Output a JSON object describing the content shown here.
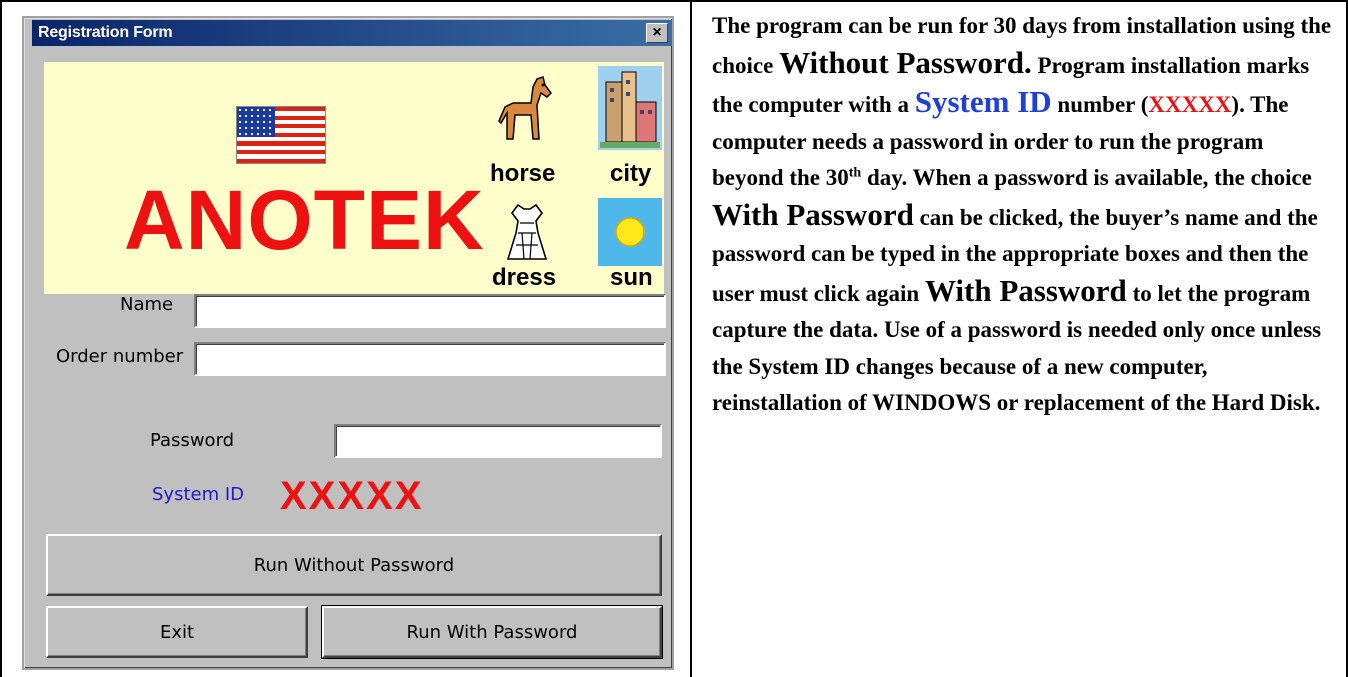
{
  "window": {
    "title": "Registration Form",
    "close_label": "×"
  },
  "banner": {
    "brand": "ANOTEK",
    "flag_icon": "us-flag-icon",
    "pictures": [
      {
        "label": "horse",
        "icon": "horse-icon"
      },
      {
        "label": "city",
        "icon": "city-icon"
      },
      {
        "label": "dress",
        "icon": "dress-icon"
      },
      {
        "label": "sun",
        "icon": "sun-icon"
      }
    ]
  },
  "form": {
    "name_label": "Name",
    "name_value": "",
    "order_label": "Order number",
    "order_value": "",
    "password_label": "Password",
    "password_value": "",
    "sysid_label": "System ID",
    "sysid_value": "XXXXX"
  },
  "buttons": {
    "run_without": "Run Without Password",
    "exit": "Exit",
    "run_with": "Run With Password"
  },
  "description": {
    "p1": "The program can be run for 30 days from installation using the choice ",
    "without_password": "Without Password.",
    "p2": " Program installation marks the computer with a ",
    "system_id": "System ID",
    "p3": " number (",
    "xxxxx": "XXXXX",
    "p4": "). The computer needs a password in order to run the program beyond the 30",
    "th": "th",
    "p5": " day. When a password is available, the choice ",
    "with_password_1": "With Password",
    "p6": " can be clicked, the buyer’s name and the password can be typed in the appropriate boxes and then the user must click again ",
    "with_password_2": "With Password",
    "p7": " to let the program capture the data. Use of a password is needed only once unless the System ID changes because of a new computer, reinstallation of WINDOWS or replacement of the Hard Disk."
  },
  "colors": {
    "brand_red": "#ee1111",
    "link_blue": "#1f3fd8",
    "banner_bg": "#ffffcc",
    "dialog_gray": "#c0c0c0",
    "title_blue": "#0a246a"
  }
}
